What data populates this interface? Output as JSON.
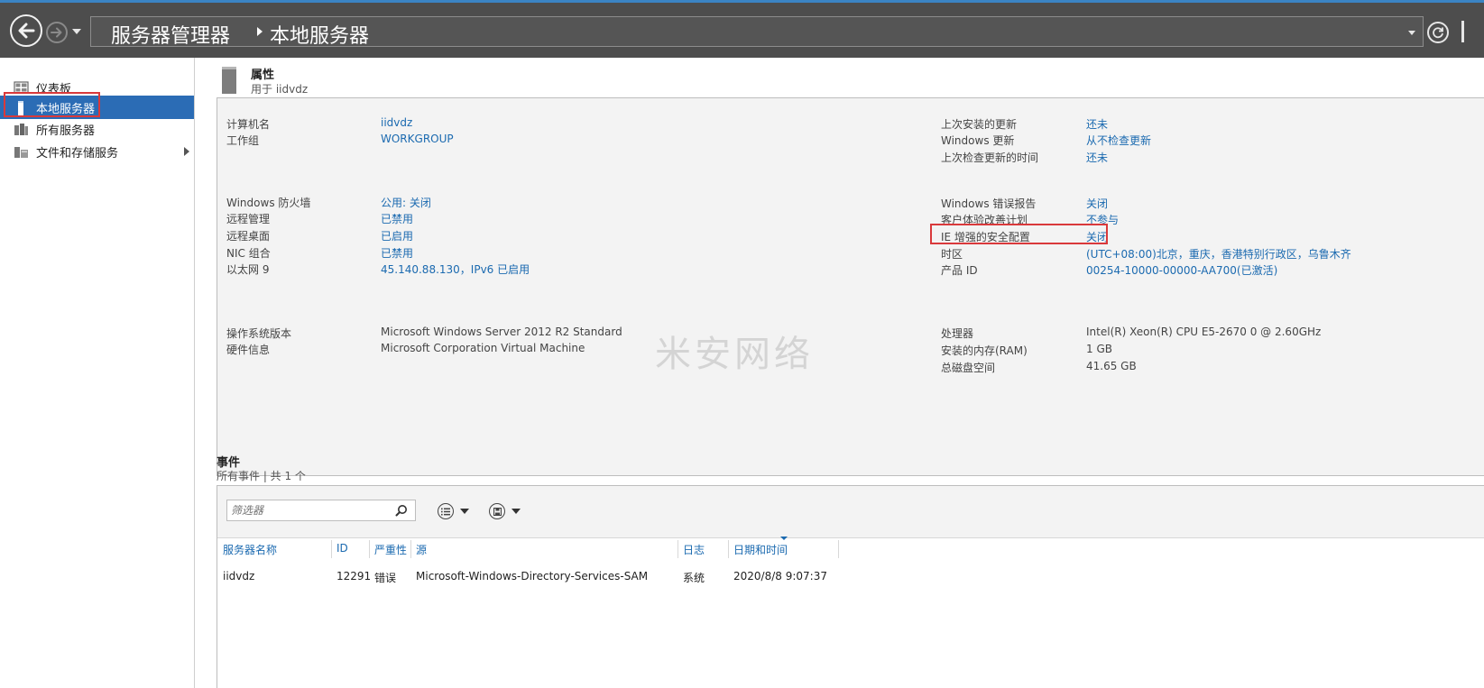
{
  "titlebar": {
    "breadcrumb_root": "服务器管理器",
    "breadcrumb_current": "本地服务器"
  },
  "sidebar": {
    "items": [
      {
        "label": "仪表板",
        "icon": "dashboard-icon"
      },
      {
        "label": "本地服务器",
        "icon": "server-icon"
      },
      {
        "label": "所有服务器",
        "icon": "servers-icon"
      },
      {
        "label": "文件和存储服务",
        "icon": "file-storage-icon"
      }
    ]
  },
  "properties": {
    "title": "属性",
    "subtitle": "用于 iidvdz",
    "left": [
      {
        "label": "计算机名",
        "value": "iidvdz"
      },
      {
        "label": "工作组",
        "value": "WORKGROUP"
      },
      {
        "label": "Windows 防火墙",
        "value": "公用: 关闭"
      },
      {
        "label": "远程管理",
        "value": "已禁用"
      },
      {
        "label": "远程桌面",
        "value": "已启用"
      },
      {
        "label": "NIC 组合",
        "value": "已禁用"
      },
      {
        "label": "以太网 9",
        "value": "45.140.88.130，IPv6 已启用"
      },
      {
        "label": "操作系统版本",
        "value": "Microsoft Windows Server 2012 R2 Standard"
      },
      {
        "label": "硬件信息",
        "value": "Microsoft Corporation Virtual Machine"
      }
    ],
    "right": [
      {
        "label": "上次安装的更新",
        "value": "还未"
      },
      {
        "label": "Windows 更新",
        "value": "从不检查更新"
      },
      {
        "label": "上次检查更新的时间",
        "value": "还未"
      },
      {
        "label": "Windows 错误报告",
        "value": "关闭"
      },
      {
        "label": "客户体验改善计划",
        "value": "不参与"
      },
      {
        "label": "IE 增强的安全配置",
        "value": "关闭"
      },
      {
        "label": "时区",
        "value": "(UTC+08:00)北京，重庆，香港特别行政区，乌鲁木齐"
      },
      {
        "label": "产品 ID",
        "value": "00254-10000-00000-AA700(已激活)"
      },
      {
        "label": "处理器",
        "value": "Intel(R) Xeon(R) CPU E5-2670 0 @ 2.60GHz"
      },
      {
        "label": "安装的内存(RAM)",
        "value": "1 GB"
      },
      {
        "label": "总磁盘空间",
        "value": "41.65 GB"
      }
    ]
  },
  "watermark": "米安网络",
  "events": {
    "title": "事件",
    "subtitle": "所有事件 | 共 1 个",
    "filter_placeholder": "筛选器",
    "columns": [
      "服务器名称",
      "ID",
      "严重性",
      "源",
      "日志",
      "日期和时间"
    ],
    "rows": [
      [
        "iidvdz",
        "12291",
        "错误",
        "Microsoft-Windows-Directory-Services-SAM",
        "系统",
        "2020/8/8 9:07:37"
      ]
    ]
  },
  "colors": {
    "titlebar_bg": "#4d4d4d",
    "selection_blue": "#2b6cb5",
    "link_blue": "#1b6ab0",
    "highlight_red": "#d9393b",
    "panel_bg": "#f3f3f3"
  }
}
